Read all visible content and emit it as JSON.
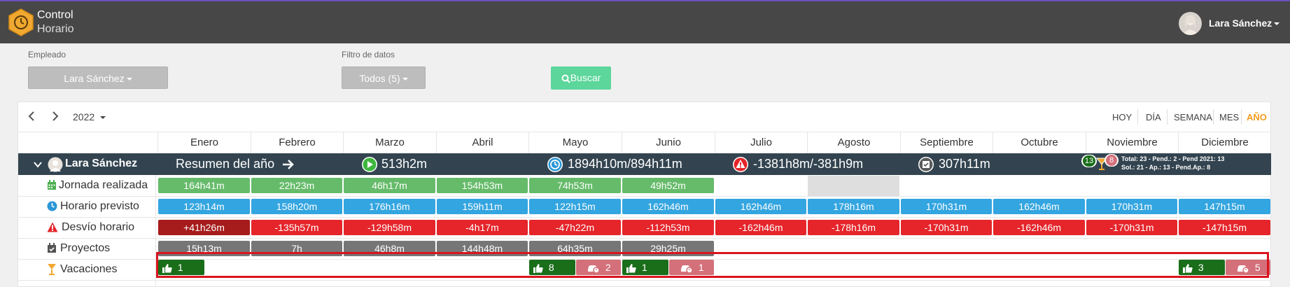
{
  "header": {
    "brand_line1": "Control",
    "brand_line2": "Horario",
    "user_name": "Lara Sánchez"
  },
  "filters": {
    "employee_label": "Empleado",
    "employee_value": "Lara Sánchez",
    "data_filter_label": "Filtro de datos",
    "data_filter_value": "Todos (5)",
    "search_label": "Buscar"
  },
  "calendar": {
    "year": "2022",
    "views": [
      "HOY",
      "DÍA",
      "SEMANA",
      "MES",
      "AÑO"
    ],
    "active_view": "AÑO",
    "months": [
      "Enero",
      "Febrero",
      "Marzo",
      "Abril",
      "Mayo",
      "Junio",
      "Julio",
      "Agosto",
      "Septiembre",
      "Octubre",
      "Noviembre",
      "Diciembre"
    ]
  },
  "summary": {
    "employee": "Lara Sánchez",
    "label": "Resumen del año",
    "worked": "513h2m",
    "planned": "1894h10m/894h11m",
    "deviation": "-1381h8m/-381h9m",
    "projects": "307h11m",
    "vacation_badge_approved": "13",
    "vacation_badge_pending": "8",
    "vacation_line1": "Total: 23 - Pend.: 2 - Pend 2021: 13",
    "vacation_line2": "Sol.: 21 - Ap.: 13 - Pend.Ap.: 8"
  },
  "rows": {
    "labels": [
      "Jornada realizada",
      "Horario previsto",
      "Desvío horario",
      "Proyectos",
      "Vacaciones"
    ],
    "jornada": [
      "164h41m",
      "22h23m",
      "46h17m",
      "154h53m",
      "74h53m",
      "49h52m",
      "",
      "",
      "",
      "",
      "",
      ""
    ],
    "previsto": [
      "123h14m",
      "158h20m",
      "176h16m",
      "159h11m",
      "122h15m",
      "162h46m",
      "162h46m",
      "178h16m",
      "170h31m",
      "162h46m",
      "170h31m",
      "147h15m"
    ],
    "desvio": [
      "+41h26m",
      "-135h57m",
      "-129h58m",
      "-4h17m",
      "-47h22m",
      "-112h53m",
      "-162h46m",
      "-178h16m",
      "-170h31m",
      "-162h46m",
      "-170h31m",
      "-147h15m"
    ],
    "proyectos": [
      "15h13m",
      "7h",
      "46h8m",
      "144h48m",
      "64h35m",
      "29h25m",
      "",
      "",
      "",
      "",
      "",
      ""
    ],
    "vacaciones": {
      "enero_approved": "1",
      "mayo_approved": "8",
      "mayo_pending": "2",
      "junio_approved": "1",
      "junio_pending": "1",
      "diciembre_approved": "3",
      "diciembre_pending": "5"
    }
  },
  "colors": {
    "worked": "#66bb6a",
    "planned": "#33a5e0",
    "deviation": "#e5252a",
    "deviation_positive": "#a61b1b",
    "projects": "#767676",
    "approved": "#1a6e1a",
    "pending": "#d4707a",
    "active_view": "#f39a1e"
  }
}
